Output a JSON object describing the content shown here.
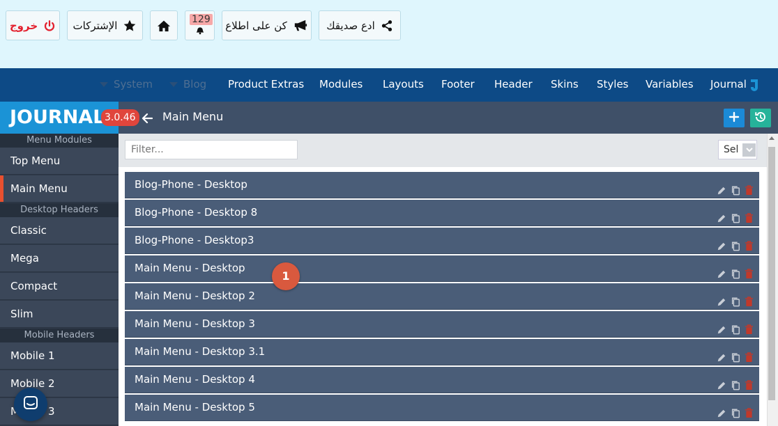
{
  "topbar": {
    "logout_label": "خروج",
    "subscriptions_label": "الإشتركات",
    "notifications_count": "129",
    "stay_informed_label": "كن على اطلاع",
    "invite_friend_label": "ادع صديقك"
  },
  "nav": {
    "items": [
      {
        "label": "System"
      },
      {
        "label": "Blog"
      },
      {
        "label": "Product Extras"
      },
      {
        "label": "Modules"
      },
      {
        "label": "Layouts"
      },
      {
        "label": "Footer"
      },
      {
        "label": "Header"
      },
      {
        "label": "Skins"
      },
      {
        "label": "Styles"
      },
      {
        "label": "Variables"
      },
      {
        "label": "Journal"
      }
    ]
  },
  "brand": {
    "logo_text": "JOURNAL",
    "version": "3.0.46"
  },
  "header": {
    "title": "Main Menu"
  },
  "sidebar": {
    "sections": [
      {
        "header": "Menu Modules",
        "items": [
          "Top Menu",
          "Main Menu"
        ]
      },
      {
        "header": "Desktop Headers",
        "items": [
          "Classic",
          "Mega",
          "Compact",
          "Slim"
        ]
      },
      {
        "header": "Mobile Headers",
        "items": [
          "Mobile 1",
          "Mobile 2",
          "Mobile 3"
        ]
      }
    ],
    "active_item": "Main Menu"
  },
  "filter": {
    "placeholder": "Filter...",
    "select_value": "Sel"
  },
  "list": {
    "rows": [
      "Blog-Phone - Desktop",
      "Blog-Phone - Desktop 8",
      "Blog-Phone - Desktop3",
      "Main Menu - Desktop",
      "Main Menu - Desktop 2",
      "Main Menu - Desktop 3",
      "Main Menu - Desktop 3.1",
      "Main Menu - Desktop 4",
      "Main Menu - Desktop 5"
    ]
  },
  "annotation": {
    "marker_label": "1"
  },
  "colors": {
    "topbar_bg": "#dff6fd",
    "navbar_bg": "#0d4a86",
    "brand_blue": "#1b93d6",
    "row_bg": "#4a5d78",
    "accent_red": "#e0453c",
    "add_button": "#1b8ad6",
    "history_button": "#26b39a"
  },
  "icons": {
    "logout": "power-icon",
    "subscriptions": "star-icon",
    "home": "home-icon",
    "notifications": "bell-icon",
    "stay_informed": "megaphone-icon",
    "invite": "share-icon",
    "back": "arrow-left-icon",
    "add": "plus-icon",
    "history": "history-icon",
    "edit": "pencil-icon",
    "copy": "copy-icon",
    "delete": "trash-icon",
    "chat": "chat-icon"
  }
}
